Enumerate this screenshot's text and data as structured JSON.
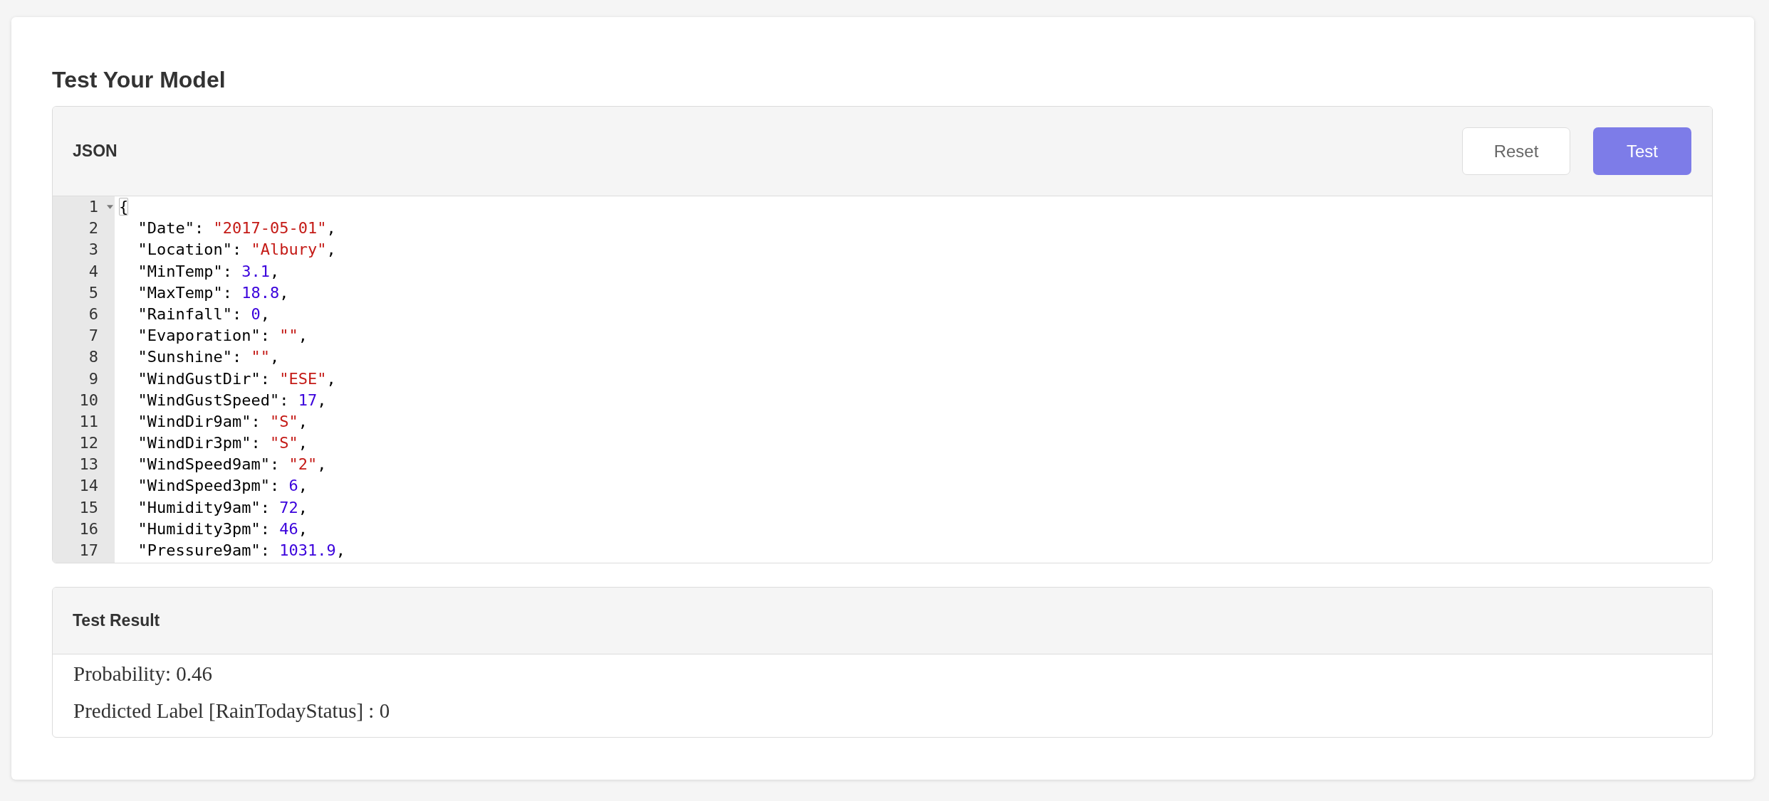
{
  "page": {
    "title": "Test Your Model"
  },
  "editor_panel": {
    "title": "JSON",
    "buttons": [
      {
        "label": "Reset",
        "kind": "outline"
      },
      {
        "label": "Test",
        "kind": "filled"
      }
    ],
    "lines": [
      {
        "number": "1",
        "expanded": true,
        "tokens": [
          {
            "kind": "brace",
            "text": "{",
            "matched": true
          }
        ],
        "children": [
          {
            "number": "2",
            "tokens": [
              {
                "kind": "key",
                "text": "\"Date\""
              },
              {
                "kind": "punct",
                "text": ": "
              },
              {
                "kind": "string",
                "text": "\"2017-05-01\""
              },
              {
                "kind": "punct",
                "text": ","
              }
            ]
          },
          {
            "number": "3",
            "tokens": [
              {
                "kind": "key",
                "text": "\"Location\""
              },
              {
                "kind": "punct",
                "text": ": "
              },
              {
                "kind": "string",
                "text": "\"Albury\""
              },
              {
                "kind": "punct",
                "text": ","
              }
            ]
          },
          {
            "number": "4",
            "tokens": [
              {
                "kind": "key",
                "text": "\"MinTemp\""
              },
              {
                "kind": "punct",
                "text": ": "
              },
              {
                "kind": "number",
                "text": "3.1"
              },
              {
                "kind": "punct",
                "text": ","
              }
            ]
          },
          {
            "number": "5",
            "tokens": [
              {
                "kind": "key",
                "text": "\"MaxTemp\""
              },
              {
                "kind": "punct",
                "text": ": "
              },
              {
                "kind": "number",
                "text": "18.8"
              },
              {
                "kind": "punct",
                "text": ","
              }
            ]
          },
          {
            "number": "6",
            "tokens": [
              {
                "kind": "key",
                "text": "\"Rainfall\""
              },
              {
                "kind": "punct",
                "text": ": "
              },
              {
                "kind": "number",
                "text": "0"
              },
              {
                "kind": "punct",
                "text": ","
              }
            ]
          },
          {
            "number": "7",
            "tokens": [
              {
                "kind": "key",
                "text": "\"Evaporation\""
              },
              {
                "kind": "punct",
                "text": ": "
              },
              {
                "kind": "string",
                "text": "\"\""
              },
              {
                "kind": "punct",
                "text": ","
              }
            ]
          },
          {
            "number": "8",
            "tokens": [
              {
                "kind": "key",
                "text": "\"Sunshine\""
              },
              {
                "kind": "punct",
                "text": ": "
              },
              {
                "kind": "string",
                "text": "\"\""
              },
              {
                "kind": "punct",
                "text": ","
              }
            ]
          },
          {
            "number": "9",
            "tokens": [
              {
                "kind": "key",
                "text": "\"WindGustDir\""
              },
              {
                "kind": "punct",
                "text": ": "
              },
              {
                "kind": "string",
                "text": "\"ESE\""
              },
              {
                "kind": "punct",
                "text": ","
              }
            ]
          },
          {
            "number": "10",
            "tokens": [
              {
                "kind": "key",
                "text": "\"WindGustSpeed\""
              },
              {
                "kind": "punct",
                "text": ": "
              },
              {
                "kind": "number",
                "text": "17"
              },
              {
                "kind": "punct",
                "text": ","
              }
            ]
          },
          {
            "number": "11",
            "tokens": [
              {
                "kind": "key",
                "text": "\"WindDir9am\""
              },
              {
                "kind": "punct",
                "text": ": "
              },
              {
                "kind": "string",
                "text": "\"S\""
              },
              {
                "kind": "punct",
                "text": ","
              }
            ]
          },
          {
            "number": "12",
            "tokens": [
              {
                "kind": "key",
                "text": "\"WindDir3pm\""
              },
              {
                "kind": "punct",
                "text": ": "
              },
              {
                "kind": "string",
                "text": "\"S\""
              },
              {
                "kind": "punct",
                "text": ","
              }
            ]
          },
          {
            "number": "13",
            "tokens": [
              {
                "kind": "key",
                "text": "\"WindSpeed9am\""
              },
              {
                "kind": "punct",
                "text": ": "
              },
              {
                "kind": "string",
                "text": "\"2\""
              },
              {
                "kind": "punct",
                "text": ","
              }
            ]
          },
          {
            "number": "14",
            "tokens": [
              {
                "kind": "key",
                "text": "\"WindSpeed3pm\""
              },
              {
                "kind": "punct",
                "text": ": "
              },
              {
                "kind": "number",
                "text": "6"
              },
              {
                "kind": "punct",
                "text": ","
              }
            ]
          },
          {
            "number": "15",
            "tokens": [
              {
                "kind": "key",
                "text": "\"Humidity9am\""
              },
              {
                "kind": "punct",
                "text": ": "
              },
              {
                "kind": "number",
                "text": "72"
              },
              {
                "kind": "punct",
                "text": ","
              }
            ]
          },
          {
            "number": "16",
            "tokens": [
              {
                "kind": "key",
                "text": "\"Humidity3pm\""
              },
              {
                "kind": "punct",
                "text": ": "
              },
              {
                "kind": "number",
                "text": "46"
              },
              {
                "kind": "punct",
                "text": ","
              }
            ]
          },
          {
            "number": "17",
            "tokens": [
              {
                "kind": "key",
                "text": "\"Pressure9am\""
              },
              {
                "kind": "punct",
                "text": ": "
              },
              {
                "kind": "number",
                "text": "1031.9"
              },
              {
                "kind": "punct",
                "text": ","
              }
            ]
          }
        ]
      }
    ]
  },
  "result_panel": {
    "title": "Test Result",
    "lines": [
      "Probability: 0.46",
      "Predicted Label [RainTodayStatus] : 0"
    ]
  }
}
